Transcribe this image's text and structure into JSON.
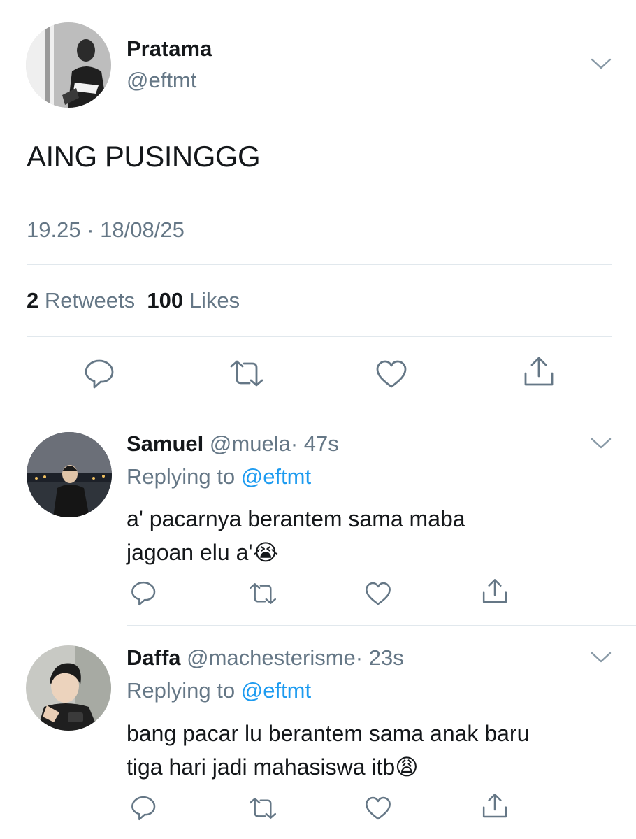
{
  "tweet": {
    "author_name": "Pratama",
    "author_handle": "@eftmt",
    "text": "AING PUSINGGG",
    "time": "19.25",
    "separator": " · ",
    "date": "18/08/25",
    "retweets_count": "2",
    "retweets_label": "Retweets",
    "likes_count": "100",
    "likes_label": "Likes"
  },
  "replies": [
    {
      "author_name": "Samuel",
      "author_handle": "@muela",
      "age": "· 47s",
      "replying_label": "Replying to",
      "replying_handle": "@eftmt",
      "line1": "a' pacarnya berantem sama maba",
      "line2": "jagoan elu a'",
      "emoji": "😭"
    },
    {
      "author_name": "Daffa",
      "author_handle": "@machesterisme",
      "age": "· 23s",
      "replying_label": "Replying to",
      "replying_handle": "@eftmt",
      "line1": "bang pacar lu berantem sama anak baru",
      "line2": "tiga hari jadi mahasiswa itb",
      "emoji": "😩"
    }
  ],
  "icons": {
    "reply": "speech-bubble-icon",
    "retweet": "retweet-icon",
    "like": "heart-icon",
    "share": "share-icon",
    "more": "chevron-down-icon"
  },
  "colors": {
    "text": "#14171a",
    "muted": "#657786",
    "link": "#1d9bf0",
    "divider": "#e1e8ed"
  }
}
